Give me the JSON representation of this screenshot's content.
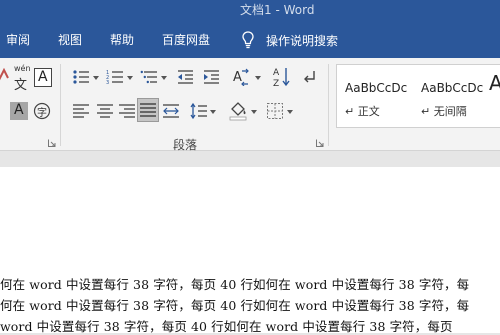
{
  "window": {
    "title": "文档1  -  Word"
  },
  "ribbon_tabs": [
    {
      "label": "审阅"
    },
    {
      "label": "视图"
    },
    {
      "label": "帮助"
    },
    {
      "label": "百度网盘"
    }
  ],
  "tell_me": {
    "label": "操作说明搜索",
    "icon": "lightbulb-icon"
  },
  "font_group": {
    "phonetic_label": "wén",
    "phonetic_glyph": "文",
    "char_border_glyph": "A",
    "shading_glyph": "A",
    "enclose_glyph": "字"
  },
  "paragraph_group": {
    "label": "段落",
    "sort_glyph": "A↓Z"
  },
  "styles_group": {
    "items": [
      {
        "sample": "AaBbCcDc",
        "name": "↵ 正文"
      },
      {
        "sample": "AaBbCcDc",
        "name": "↵ 无间隔"
      }
    ],
    "partial_sample": "A"
  },
  "document": {
    "lines": [
      "何在 word 中设置每行 38 字符，每页 40 行如何在 word 中设置每行 38 字符，每",
      "何在 word 中设置每行 38 字符，每页 40 行如何在 word 中设置每行 38 字符，每",
      "word 中设置每行 38 字符，每页 40 行如何在 word 中设置每行 38 字符，每页"
    ]
  },
  "colors": {
    "ribbon_blue": "#2b579a",
    "ribbon_body": "#f3f3f3",
    "document_bg": "#ffffff"
  }
}
